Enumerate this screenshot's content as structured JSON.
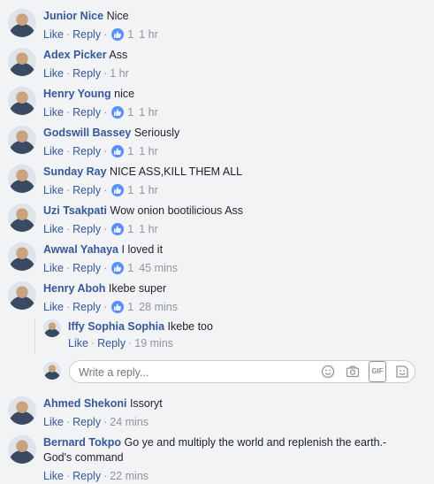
{
  "actions": {
    "like": "Like",
    "reply": "Reply",
    "separator": "·"
  },
  "comments": [
    {
      "author": "Junior Nice",
      "text": "Nice",
      "likes": "1",
      "time": "1 hr"
    },
    {
      "author": "Adex Picker",
      "text": "Ass",
      "likes": "",
      "time": "1 hr"
    },
    {
      "author": "Henry Young",
      "text": "nice",
      "likes": "1",
      "time": "1 hr"
    },
    {
      "author": "Godswill Bassey",
      "text": "Seriously",
      "likes": "1",
      "time": "1 hr"
    },
    {
      "author": "Sunday Ray",
      "text": "NICE ASS,KILL THEM ALL",
      "likes": "1",
      "time": "1 hr"
    },
    {
      "author": "Uzi Tsakpati",
      "text": "Wow onion bootilicious Ass",
      "likes": "1",
      "time": "1 hr"
    },
    {
      "author": "Awwal Yahaya",
      "text": "I loved it",
      "likes": "1",
      "time": "45 mins"
    },
    {
      "author": "Henry Aboh",
      "text": "Ikebe super",
      "likes": "1",
      "time": "28 mins"
    },
    {
      "author": "Ahmed Shekoni",
      "text": "Issoryt",
      "likes": "",
      "time": "24 mins"
    },
    {
      "author": "Bernard Tokpo",
      "text": "Go ye and multiply the world and replenish the earth.- God's command",
      "likes": "",
      "time": "22 mins"
    }
  ],
  "reply": {
    "author": "Iffy Sophia Sophia",
    "text": "Ikebe too",
    "time": "19 mins"
  },
  "reply_box": {
    "placeholder": "Write a reply...",
    "icons": [
      "emoji-icon",
      "camera-icon",
      "gif-icon",
      "sticker-icon"
    ],
    "gif_label": "GIF"
  },
  "colors": {
    "name": "#365899",
    "like_badge": "#5890ff",
    "background": "#f2f3f5"
  }
}
